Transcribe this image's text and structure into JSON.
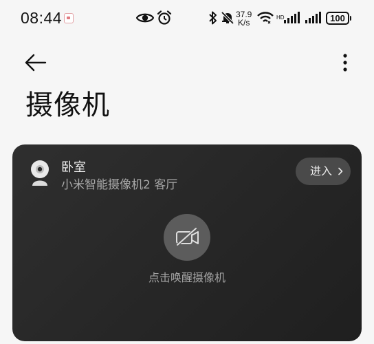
{
  "status_bar": {
    "time": "08:44",
    "net_speed_value": "37.9",
    "net_speed_unit": "K/s",
    "battery": "100",
    "icons": [
      "notification-icon",
      "eye-icon",
      "alarm-icon",
      "bluetooth-icon",
      "mute-icon",
      "wifi-icon",
      "signal-icon",
      "signal-icon",
      "battery-icon"
    ]
  },
  "toolbar": {
    "back_icon": "back-arrow-icon",
    "more_icon": "more-vertical-icon"
  },
  "page": {
    "title": "摄像机"
  },
  "camera_card": {
    "room": "卧室",
    "device": "小米智能摄像机2 客厅",
    "enter_label": "进入",
    "wake_label": "点击唤醒摄像机",
    "wake_icon": "camera-off-icon"
  },
  "colors": {
    "background": "#f6f6f6",
    "card": "#2a2a2a",
    "enter_button": "#4a4a4a",
    "wake_button": "#5c5c5c"
  }
}
